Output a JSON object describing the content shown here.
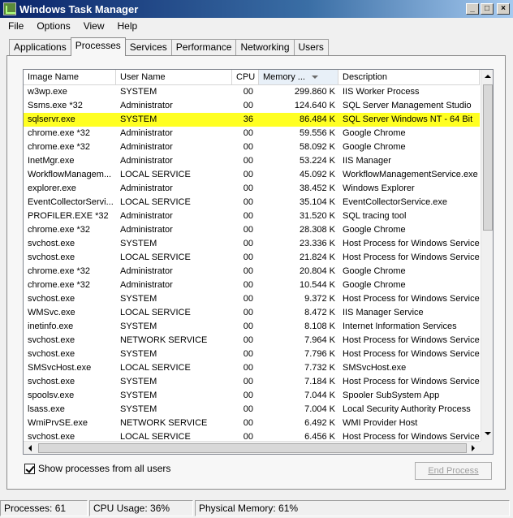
{
  "window": {
    "title": "Windows Task Manager",
    "controls": [
      "_",
      "□",
      "×"
    ]
  },
  "menu": [
    "File",
    "Options",
    "View",
    "Help"
  ],
  "tabs": [
    "Applications",
    "Processes",
    "Services",
    "Performance",
    "Networking",
    "Users"
  ],
  "active_tab": "Processes",
  "columns": {
    "image": "Image Name",
    "user": "User Name",
    "cpu": "CPU",
    "mem": "Memory ...",
    "desc": "Description"
  },
  "rows": [
    {
      "image": "w3wp.exe",
      "user": "SYSTEM",
      "cpu": "00",
      "mem": "299.860 K",
      "desc": "IIS Worker Process"
    },
    {
      "image": "Ssms.exe *32",
      "user": "Administrator",
      "cpu": "00",
      "mem": "124.640 K",
      "desc": "SQL Server Management Studio"
    },
    {
      "image": "sqlservr.exe",
      "user": "SYSTEM",
      "cpu": "36",
      "mem": "86.484 K",
      "desc": "SQL Server Windows NT - 64 Bit"
    },
    {
      "image": "chrome.exe *32",
      "user": "Administrator",
      "cpu": "00",
      "mem": "59.556 K",
      "desc": "Google Chrome"
    },
    {
      "image": "chrome.exe *32",
      "user": "Administrator",
      "cpu": "00",
      "mem": "58.092 K",
      "desc": "Google Chrome"
    },
    {
      "image": "InetMgr.exe",
      "user": "Administrator",
      "cpu": "00",
      "mem": "53.224 K",
      "desc": "IIS Manager"
    },
    {
      "image": "WorkflowManagem...",
      "user": "LOCAL SERVICE",
      "cpu": "00",
      "mem": "45.092 K",
      "desc": "WorkflowManagementService.exe"
    },
    {
      "image": "explorer.exe",
      "user": "Administrator",
      "cpu": "00",
      "mem": "38.452 K",
      "desc": "Windows Explorer"
    },
    {
      "image": "EventCollectorServi...",
      "user": "LOCAL SERVICE",
      "cpu": "00",
      "mem": "35.104 K",
      "desc": "EventCollectorService.exe"
    },
    {
      "image": "PROFILER.EXE *32",
      "user": "Administrator",
      "cpu": "00",
      "mem": "31.520 K",
      "desc": "SQL tracing tool"
    },
    {
      "image": "chrome.exe *32",
      "user": "Administrator",
      "cpu": "00",
      "mem": "28.308 K",
      "desc": "Google Chrome"
    },
    {
      "image": "svchost.exe",
      "user": "SYSTEM",
      "cpu": "00",
      "mem": "23.336 K",
      "desc": "Host Process for Windows Services"
    },
    {
      "image": "svchost.exe",
      "user": "LOCAL SERVICE",
      "cpu": "00",
      "mem": "21.824 K",
      "desc": "Host Process for Windows Services"
    },
    {
      "image": "chrome.exe *32",
      "user": "Administrator",
      "cpu": "00",
      "mem": "20.804 K",
      "desc": "Google Chrome"
    },
    {
      "image": "chrome.exe *32",
      "user": "Administrator",
      "cpu": "00",
      "mem": "10.544 K",
      "desc": "Google Chrome"
    },
    {
      "image": "svchost.exe",
      "user": "SYSTEM",
      "cpu": "00",
      "mem": "9.372 K",
      "desc": "Host Process for Windows Services"
    },
    {
      "image": "WMSvc.exe",
      "user": "LOCAL SERVICE",
      "cpu": "00",
      "mem": "8.472 K",
      "desc": "IIS Manager Service"
    },
    {
      "image": "inetinfo.exe",
      "user": "SYSTEM",
      "cpu": "00",
      "mem": "8.108 K",
      "desc": "Internet Information Services"
    },
    {
      "image": "svchost.exe",
      "user": "NETWORK SERVICE",
      "cpu": "00",
      "mem": "7.964 K",
      "desc": "Host Process for Windows Services"
    },
    {
      "image": "svchost.exe",
      "user": "SYSTEM",
      "cpu": "00",
      "mem": "7.796 K",
      "desc": "Host Process for Windows Services"
    },
    {
      "image": "SMSvcHost.exe",
      "user": "LOCAL SERVICE",
      "cpu": "00",
      "mem": "7.732 K",
      "desc": "SMSvcHost.exe"
    },
    {
      "image": "svchost.exe",
      "user": "SYSTEM",
      "cpu": "00",
      "mem": "7.184 K",
      "desc": "Host Process for Windows Services"
    },
    {
      "image": "spoolsv.exe",
      "user": "SYSTEM",
      "cpu": "00",
      "mem": "7.044 K",
      "desc": "Spooler SubSystem App"
    },
    {
      "image": "lsass.exe",
      "user": "SYSTEM",
      "cpu": "00",
      "mem": "7.004 K",
      "desc": "Local Security Authority Process"
    },
    {
      "image": "WmiPrvSE.exe",
      "user": "NETWORK SERVICE",
      "cpu": "00",
      "mem": "6.492 K",
      "desc": "WMI Provider Host"
    },
    {
      "image": "svchost.exe",
      "user": "LOCAL SERVICE",
      "cpu": "00",
      "mem": "6.456 K",
      "desc": "Host Process for Windows Services"
    }
  ],
  "highlighted_row_index": 2,
  "highlight_color": "#ffff22",
  "show_all_label": "Show processes from all users",
  "show_all_checked": true,
  "end_process_label": "End Process",
  "status": {
    "processes": "Processes: 61",
    "cpu": "CPU Usage: 36%",
    "memory": "Physical Memory: 61%"
  }
}
